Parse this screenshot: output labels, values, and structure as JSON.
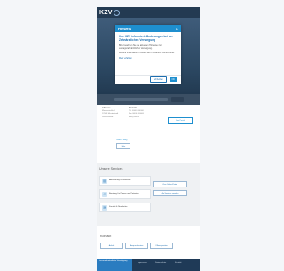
{
  "header": {
    "logo_text": "KZV"
  },
  "modal": {
    "title": "Hinweis",
    "close": "✕",
    "headline": "Ihre KZV informiert: Änderungen bei der Zahnärztlichen Versorgung",
    "text1": "Bitte beachten Sie die aktuellen Hinweise zur vertragszahnärztlichen Versorgung.",
    "text2": "Weitere Informationen finden Sie in unserem Online-Portal.",
    "link": "Mehr erfahren",
    "btn_secondary": "Schließen",
    "btn_primary": "OK"
  },
  "hero": {
    "search_placeholder": "",
    "search_button": ""
  },
  "info": {
    "columns": [
      {
        "heading": "Adresse",
        "lines": [
          "Musterstraße 1",
          "12345 Musterstadt",
          "Deutschland"
        ]
      },
      {
        "heading": "Kontakt",
        "lines": [
          "Tel. 0000 000000",
          "Fax 0000 000000",
          "info@kzv.de"
        ]
      }
    ],
    "button": "Zum Portal"
  },
  "help": {
    "link": "Hilfe & FAQ",
    "button": "Mehr"
  },
  "services": {
    "title": "Unsere Services",
    "items": [
      {
        "icon": "document-icon",
        "glyph": "▤",
        "text": "Abrechnung & Formulare"
      },
      {
        "icon": "people-icon",
        "glyph": "☺",
        "text": "Beratung für Praxen und Patienten"
      },
      {
        "icon": "mail-icon",
        "glyph": "✉",
        "text": "Kontakt & Newsletter"
      }
    ],
    "links": [
      "Zum Online-Portal",
      "Alle Services ansehen"
    ]
  },
  "contact": {
    "title": "Kontakt",
    "buttons": [
      "Anfahrt",
      "Ansprechpartner",
      "Öffnungszeiten"
    ]
  },
  "footer": {
    "blue_text": "Kassenzahnärztliche Vereinigung",
    "items": [
      "Impressum",
      "Datenschutz",
      "Kontakt"
    ]
  }
}
